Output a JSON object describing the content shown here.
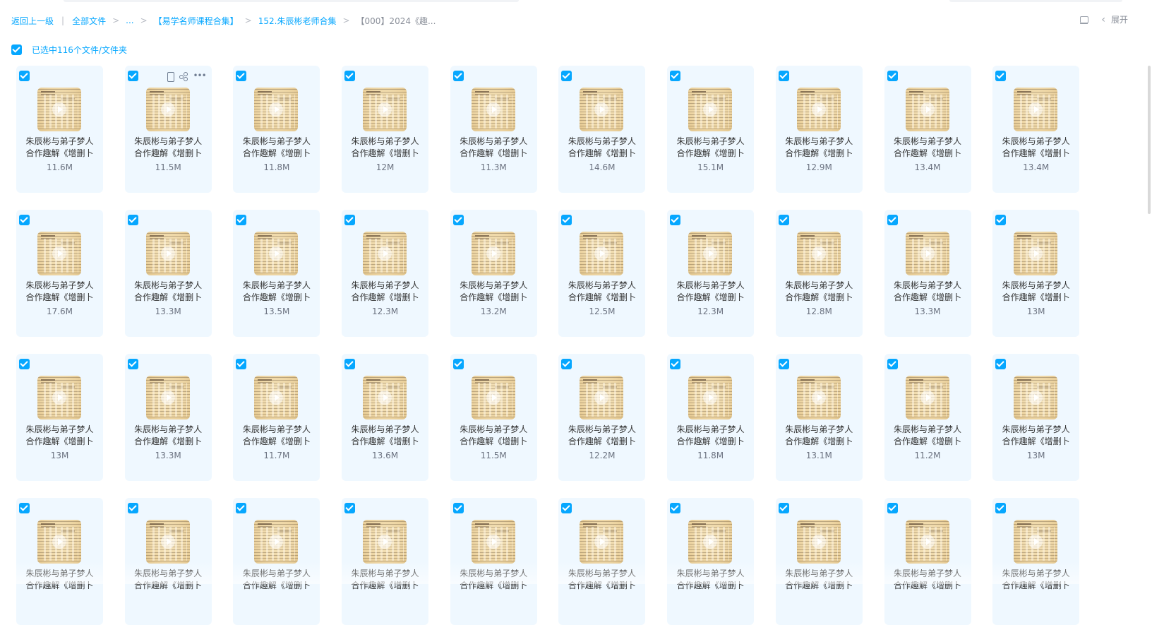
{
  "breadcrumb": {
    "back": "返回上一级",
    "items": [
      "全部文件",
      "...",
      "【易学名师课程合集】",
      "152.朱辰彬老师合集"
    ],
    "current": "【000】2024《趣..."
  },
  "toolbar": {
    "expand_label": "展开"
  },
  "selection": {
    "label": "已选中116个文件/文件夹"
  },
  "files": {
    "title_line1": "朱辰彬与弟子梦人",
    "title_line2": "合作趣解《增删卜",
    "sizes": [
      "11.6M",
      "11.5M",
      "11.8M",
      "12M",
      "11.3M",
      "14.6M",
      "15.1M",
      "12.9M",
      "13.4M",
      "13.4M",
      "17.6M",
      "13.3M",
      "13.5M",
      "12.3M",
      "13.2M",
      "12.5M",
      "12.3M",
      "12.8M",
      "13.3M",
      "13M",
      "13M",
      "13.3M",
      "11.7M",
      "13.6M",
      "11.5M",
      "12.2M",
      "11.8M",
      "13.1M",
      "11.2M",
      "13M",
      "",
      "",
      "",
      "",
      "",
      "",
      "",
      "",
      "",
      ""
    ]
  },
  "colors": {
    "accent": "#06a7ff",
    "card_bg": "#eff8ff"
  }
}
